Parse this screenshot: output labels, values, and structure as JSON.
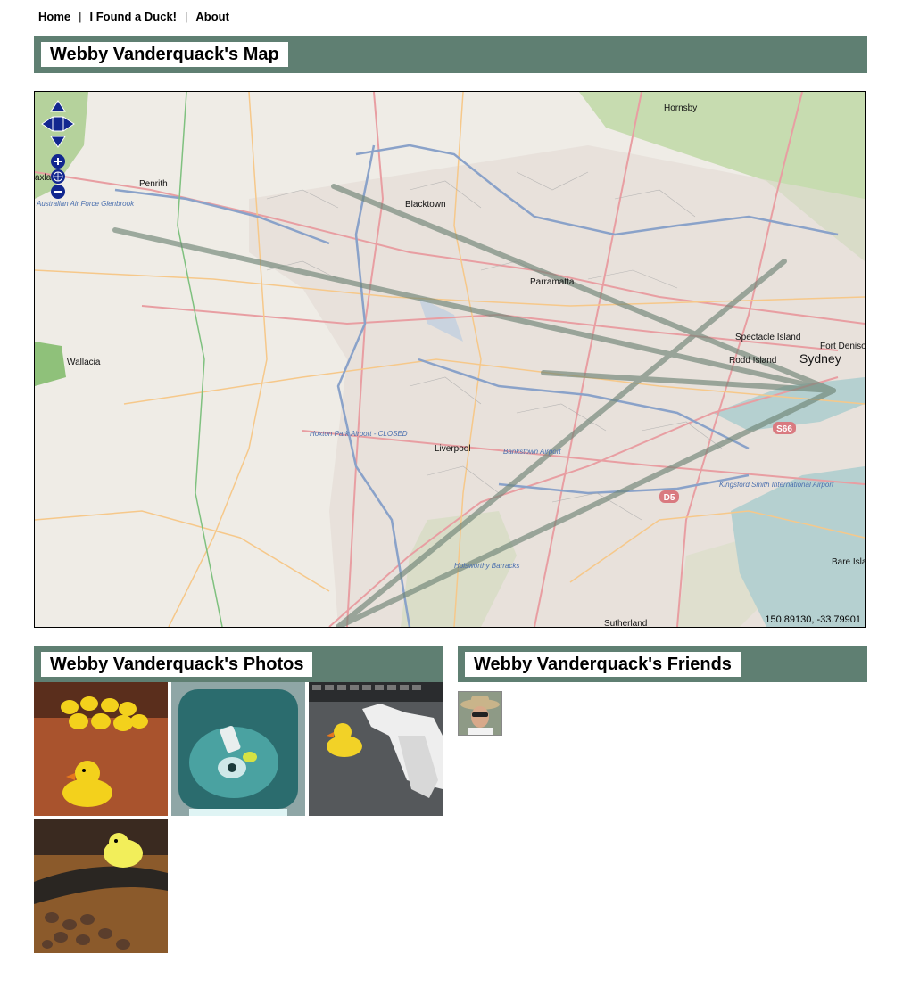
{
  "nav": {
    "home": "Home",
    "found": "I Found a Duck!",
    "about": "About",
    "separator": "|"
  },
  "map_section": {
    "title": "Webby Vanderquack's Map",
    "coordinates": "150.89130, -33.79901",
    "places": {
      "hornsby": "Hornsby",
      "penrith": "Penrith",
      "blacktown": "Blacktown",
      "parramatta": "Parramatta",
      "sydney": "Sydney",
      "wallacia": "Wallacia",
      "liverpool": "Liverpool",
      "sutherland": "Sutherland",
      "spectacle_island": "Spectacle Island",
      "rodd_island": "Rodd Island",
      "fort_denison": "Fort Denison",
      "bare_island": "Bare Island",
      "hoxton_park": "Hoxton Park Airport - CLOSED",
      "bankstown": "Bankstown Airport",
      "kingsford_smith": "Kingsford Smith International Airport",
      "holsworthy": "Holsworthy Barracks",
      "raaf_glenbrook": "Australian Air Force Glenbrook",
      "taxla": "axla",
      "s66": "S66",
      "d5": "D5"
    },
    "controls": [
      "pan-up-icon",
      "pan-left-icon",
      "pan-right-icon",
      "pan-down-icon",
      "zoom-in-icon",
      "world-icon",
      "zoom-out-icon"
    ]
  },
  "photos_section": {
    "title": "Webby Vanderquack's Photos",
    "photos": [
      "duck-group-photo",
      "duck-in-sink-photo",
      "duck-with-phone-photo",
      "duck-on-rocks-photo"
    ]
  },
  "friends_section": {
    "title": "Webby Vanderquack's Friends",
    "friends": [
      "friend-avatar"
    ]
  },
  "colors": {
    "section_bar": "#5f7f72",
    "map_background": "#efece6",
    "path_line": "#6f8577"
  }
}
